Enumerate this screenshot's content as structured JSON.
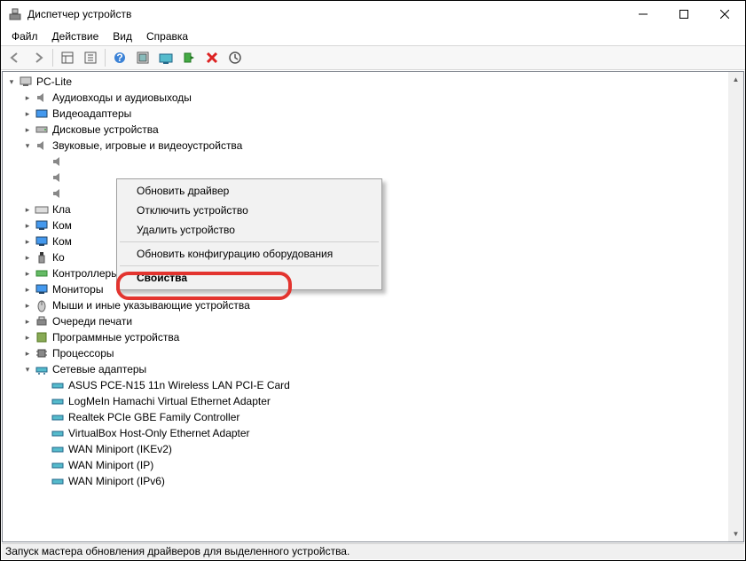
{
  "window": {
    "title": "Диспетчер устройств"
  },
  "menus": {
    "file": "Файл",
    "action": "Действие",
    "view": "Вид",
    "help": "Справка"
  },
  "tree": {
    "root": "PC-Lite",
    "audio_io": "Аудиовходы и аудиовыходы",
    "video": "Видеоадаптеры",
    "disk": "Дисковые устройства",
    "sound": "Звуковые, игровые и видеоустройства",
    "sound_sub1": "",
    "sound_sub2": "",
    "sound_sub3": "",
    "keyboard": "Кла",
    "computer": "Ком",
    "computer2": "Ком",
    "usb": "Ко",
    "storage": "Контроллеры запоминающих устройств",
    "monitors": "Мониторы",
    "mice": "Мыши и иные указывающие устройства",
    "printq": "Очереди печати",
    "software": "Программные устройства",
    "cpu": "Процессоры",
    "net": "Сетевые адаптеры",
    "nic1": "ASUS PCE-N15 11n Wireless LAN PCI-E Card",
    "nic2": "LogMeIn Hamachi Virtual Ethernet Adapter",
    "nic3": "Realtek PCIe GBE Family Controller",
    "nic4": "VirtualBox Host-Only Ethernet Adapter",
    "nic5": "WAN Miniport (IKEv2)",
    "nic6": "WAN Miniport (IP)",
    "nic7": "WAN Miniport (IPv6)"
  },
  "context_menu": {
    "update": "Обновить драйвер",
    "disable": "Отключить устройство",
    "remove": "Удалить устройство",
    "rescan": "Обновить конфигурацию оборудования",
    "props": "Свойства"
  },
  "status": "Запуск мастера обновления драйверов для выделенного устройства."
}
